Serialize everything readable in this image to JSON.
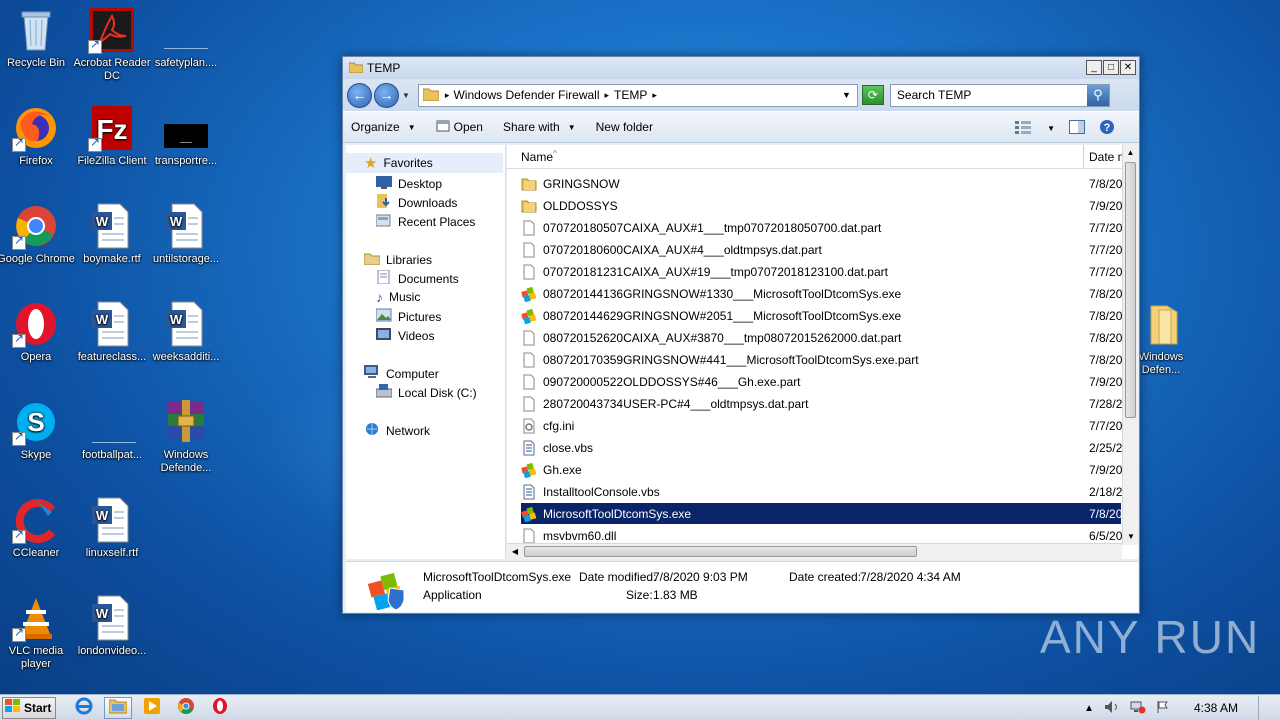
{
  "desktop": {
    "icons": [
      {
        "label": "Recycle Bin"
      },
      {
        "label": "Acrobat Reader DC"
      },
      {
        "label": "safetyplan...."
      },
      {
        "label": "Firefox"
      },
      {
        "label": "FileZilla Client"
      },
      {
        "label": "transportre..."
      },
      {
        "label": "Google Chrome"
      },
      {
        "label": "boymake.rtf"
      },
      {
        "label": "untilstorage..."
      },
      {
        "label": "Opera"
      },
      {
        "label": "featureclass..."
      },
      {
        "label": "weeksadditi..."
      },
      {
        "label": "Skype"
      },
      {
        "label": "footballpat..."
      },
      {
        "label": "Windows Defende..."
      },
      {
        "label": "CCleaner"
      },
      {
        "label": "linuxself.rtf"
      },
      {
        "label": "VLC media player"
      },
      {
        "label": "londonvideo..."
      },
      {
        "label": "Windows Defen..."
      }
    ],
    "watermark": "ANY RUN"
  },
  "window": {
    "title": "TEMP",
    "min_btn": "_",
    "max_btn": "□",
    "close_btn": "✕",
    "address": {
      "segments": [
        "Windows Defender Firewall",
        "TEMP"
      ],
      "separator": "▸"
    },
    "search_placeholder": "Search TEMP",
    "toolbar": {
      "organize": "Organize",
      "open": "Open",
      "share_with": "Share with",
      "new_folder": "New folder"
    },
    "nav": {
      "favorites": "Favorites",
      "desktop": "Desktop",
      "downloads": "Downloads",
      "recent": "Recent Places",
      "libraries": "Libraries",
      "documents": "Documents",
      "music": "Music",
      "pictures": "Pictures",
      "videos": "Videos",
      "computer": "Computer",
      "local_disk": "Local Disk (C:)",
      "network": "Network"
    },
    "columns": {
      "name": "Name",
      "date": "Date m"
    },
    "files": [
      {
        "name": "GRINGSNOW",
        "date": "7/8/20",
        "type": "folder"
      },
      {
        "name": "OLDDOSSYS",
        "date": "7/9/20",
        "type": "folder"
      },
      {
        "name": "070720180507CAIXA_AUX#1___tmp07072018050700.dat.part",
        "date": "7/7/20",
        "type": "file"
      },
      {
        "name": "070720180600CAIXA_AUX#4___oldtmpsys.dat.part",
        "date": "7/7/20",
        "type": "file"
      },
      {
        "name": "070720181231CAIXA_AUX#19___tmp07072018123100.dat.part",
        "date": "7/7/20",
        "type": "file"
      },
      {
        "name": "080720144136GRINGSNOW#1330___MicrosoftToolDtcomSys.exe",
        "date": "7/8/20",
        "type": "exe"
      },
      {
        "name": "080720144629GRINGSNOW#2051___MicrosoftToolDtcomSys.exe",
        "date": "7/8/20",
        "type": "exe"
      },
      {
        "name": "080720152620CAIXA_AUX#3870___tmp08072015262000.dat.part",
        "date": "7/8/20",
        "type": "file"
      },
      {
        "name": "080720170359GRINGSNOW#441___MicrosoftToolDtcomSys.exe.part",
        "date": "7/8/20",
        "type": "file"
      },
      {
        "name": "090720000522OLDDOSSYS#46___Gh.exe.part",
        "date": "7/9/20",
        "type": "file"
      },
      {
        "name": "280720043734USER-PC#4___oldtmpsys.dat.part",
        "date": "7/28/2",
        "type": "file"
      },
      {
        "name": "cfg.ini",
        "date": "7/7/20",
        "type": "ini"
      },
      {
        "name": "close.vbs",
        "date": "2/25/2",
        "type": "vbs"
      },
      {
        "name": "Gh.exe",
        "date": "7/9/20",
        "type": "exe"
      },
      {
        "name": "InstalltoolConsole.vbs",
        "date": "2/18/2",
        "type": "vbs"
      },
      {
        "name": "MicrosoftToolDtcomSys.exe",
        "date": "7/8/20",
        "type": "exe",
        "selected": true
      },
      {
        "name": "msvbvm60.dll",
        "date": "6/5/20",
        "type": "file"
      }
    ],
    "details": {
      "filename": "MicrosoftToolDtcomSys.exe",
      "type": "Application",
      "modified_label": "Date modified:",
      "modified": "7/8/2020 9:03 PM",
      "created_label": "Date created:",
      "created": "7/28/2020 4:34 AM",
      "size_label": "Size:",
      "size": "1.83 MB"
    }
  },
  "taskbar": {
    "start": "Start",
    "time": "4:38 AM"
  },
  "colors": {
    "selection": "#0a246a",
    "wallpaper": "#1a72c8"
  }
}
